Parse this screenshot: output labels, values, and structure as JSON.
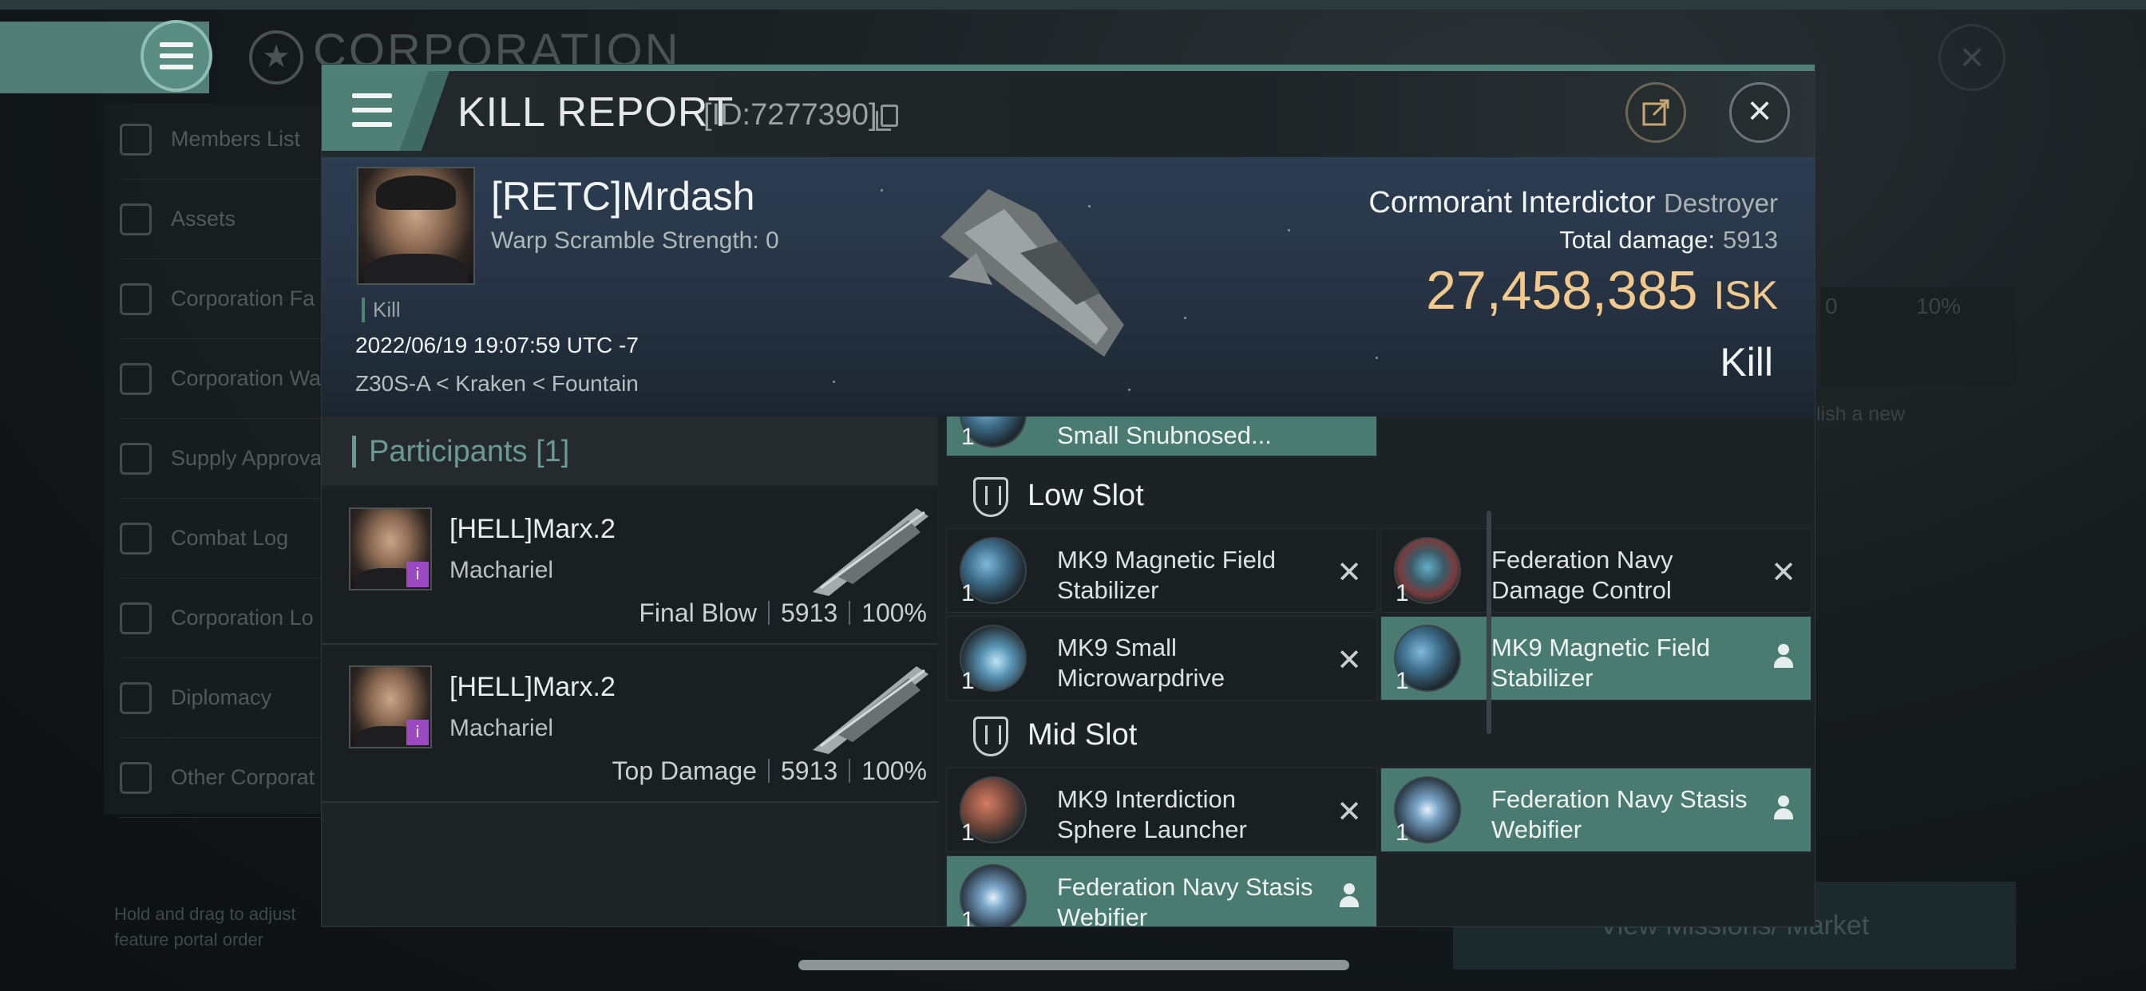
{
  "background": {
    "page_title": "CORPORATION",
    "sidebar": [
      "Members List",
      "Assets",
      "Corporation Fa",
      "Corporation Wa",
      "Supply Approva",
      "Combat Log",
      "Corporation Lo",
      "Diplomacy",
      "Other Corporat"
    ],
    "hint": "Hold and drag to adjust feature portal order",
    "right_value": "0",
    "right_percent": "10%",
    "publish_hint": "lish a new",
    "mission_button": "View Missions/ Market"
  },
  "modal": {
    "title": "KILL REPORT",
    "id": "[ID:7277390]",
    "icons": {
      "menu": "hamburger-icon",
      "copy": "copy-icon",
      "share": "share-icon",
      "close": "close-icon"
    }
  },
  "victim": {
    "name": "[RETC]Mrdash",
    "warp_scramble": "Warp Scramble Strength: 0",
    "kill_label": "Kill",
    "datetime": "2022/06/19 19:07:59 UTC -7",
    "location": "Z30S-A < Kraken < Fountain",
    "ship_name": "Cormorant Interdictor",
    "ship_class": "Destroyer",
    "total_damage_label": "Total damage:",
    "total_damage": "5913",
    "isk_value": "27,458,385",
    "isk_unit": "ISK",
    "result": "Kill"
  },
  "participants": {
    "title": "Participants [1]",
    "rows": [
      {
        "name": "[HELL]Marx.2",
        "ship": "Machariel",
        "role": "Final Blow",
        "damage": "5913",
        "percent": "100%",
        "badge": "i"
      },
      {
        "name": "[HELL]Marx.2",
        "ship": "Machariel",
        "role": "Top Damage",
        "damage": "5913",
        "percent": "100%",
        "badge": "i"
      }
    ]
  },
  "fitting": {
    "top_partial": {
      "qty": "1",
      "name": "Small Snubnosed..."
    },
    "low_slot_label": "Low Slot",
    "mid_slot_label": "Mid Slot",
    "low": [
      {
        "qty": "1",
        "name": "MK9 Magnetic Field Stabilizer",
        "status": "destroyed",
        "icon": "stabilizer-icon"
      },
      {
        "qty": "1",
        "name": "Federation Navy Damage Control",
        "status": "destroyed",
        "icon": "damage-control-icon"
      },
      {
        "qty": "1",
        "name": "MK9 Small Microwarpdrive",
        "status": "destroyed",
        "icon": "microwarpdrive-icon"
      },
      {
        "qty": "1",
        "name": "MK9 Magnetic Field Stabilizer",
        "status": "dropped",
        "icon": "stabilizer-icon"
      }
    ],
    "mid": [
      {
        "qty": "1",
        "name": "MK9 Interdiction Sphere Launcher",
        "status": "destroyed",
        "icon": "launcher-icon"
      },
      {
        "qty": "1",
        "name": "Federation Navy Stasis Webifier",
        "status": "dropped",
        "icon": "webifier-icon"
      },
      {
        "qty": "1",
        "name": "Federation Navy Stasis Webifier",
        "status": "dropped",
        "icon": "webifier-icon"
      }
    ],
    "colors": {
      "dropped": "#4a7b71",
      "destroyed": "#1a1f21",
      "isk": "#f2c98c"
    }
  }
}
